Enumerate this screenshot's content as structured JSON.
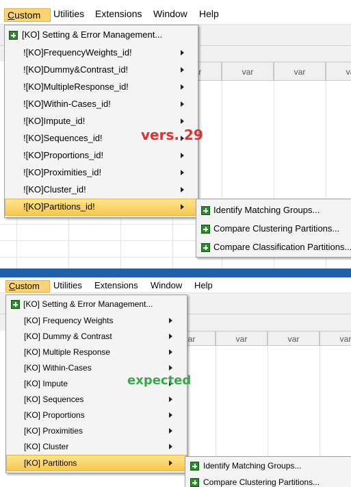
{
  "colors": {
    "divider": "#1f5fa8",
    "highlight": "#fcd572",
    "overlay_top": "#e03030",
    "overlay_bottom": "#3aa84a"
  },
  "top": {
    "menubar": [
      "Custom",
      "Utilities",
      "Extensions",
      "Window",
      "Help"
    ],
    "var_label": "var",
    "menu_items": [
      "[KO] Setting & Error Management...",
      "![KO]FrequencyWeights_id!",
      "![KO]Dummy&Contrast_id!",
      "![KO]MultipleResponse_id!",
      "![KO]Within-Cases_id!",
      "![KO]Impute_id!",
      "![KO]Sequences_id!",
      "![KO]Proportions_id!",
      "![KO]Proximities_id!",
      "![KO]Cluster_id!",
      "![KO]Partitions_id!"
    ],
    "submenu": [
      "Identify Matching Groups...",
      "Compare Clustering Partitions...",
      "Compare Classification Partitions..."
    ],
    "overlay": "vers. 29"
  },
  "bottom": {
    "menubar": [
      "Custom",
      "Utilities",
      "Extensions",
      "Window",
      "Help"
    ],
    "var_label": "var",
    "menu_items": [
      "[KO] Setting & Error Management...",
      "[KO] Frequency Weights",
      "[KO] Dummy & Contrast",
      "[KO] Multiple Response",
      "[KO] Within-Cases",
      "[KO] Impute",
      "[KO] Sequences",
      "[KO] Proportions",
      "[KO] Proximities",
      "[KO] Cluster",
      "[KO] Partitions"
    ],
    "submenu": [
      "Identify Matching Groups...",
      "Compare Clustering Partitions..."
    ],
    "overlay": "expected"
  }
}
